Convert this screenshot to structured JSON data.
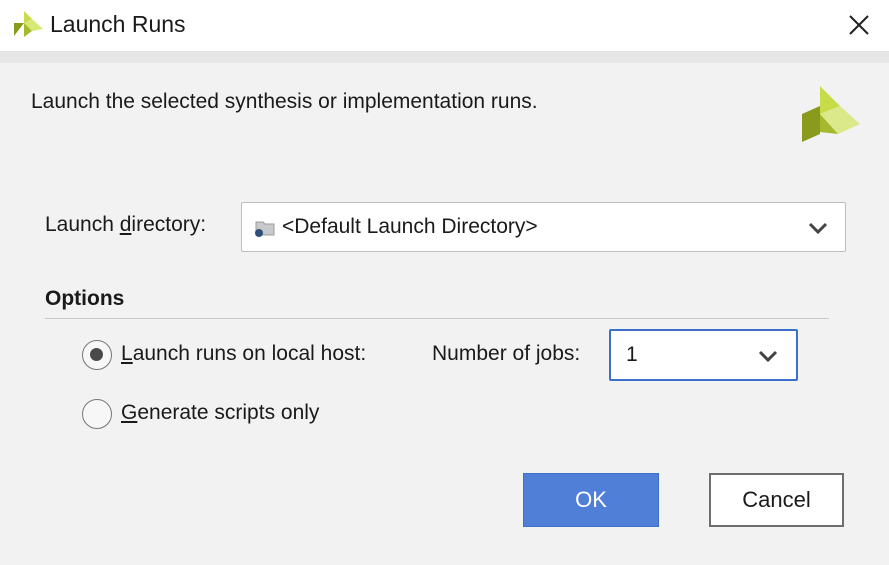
{
  "window": {
    "title": "Launch Runs",
    "app_icon": "vivado-logo-icon",
    "close_icon": "close-icon"
  },
  "description": "Launch the selected synthesis or implementation runs.",
  "brand_logo": "xilinx-logo-icon",
  "launch_directory": {
    "label_prefix": "Launch ",
    "label_mnemonic": "d",
    "label_suffix": "irectory:",
    "value": "<Default Launch Directory>",
    "icon": "folder-icon",
    "dropdown_icon": "chevron-down-icon"
  },
  "options": {
    "heading": "Options",
    "local_host": {
      "mnemonic": "L",
      "label_rest": "aunch runs on local host:",
      "selected": true
    },
    "jobs": {
      "label_prefix": "Number of ",
      "label_mnemonic": "j",
      "label_suffix": "obs:",
      "value": "1"
    },
    "scripts_only": {
      "mnemonic": "G",
      "label_rest": "enerate scripts only",
      "selected": false
    }
  },
  "buttons": {
    "ok": "OK",
    "cancel": "Cancel"
  },
  "colors": {
    "accent": "#4f7fd6",
    "focus_border": "#3b6fc9",
    "logo_green_light": "#c8dc4a",
    "logo_green_dark": "#8a9a1c"
  }
}
